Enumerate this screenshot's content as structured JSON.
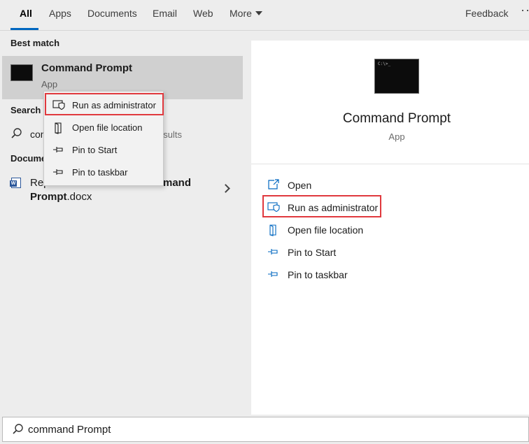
{
  "tabs": [
    {
      "label": "All",
      "active": true
    },
    {
      "label": "Apps"
    },
    {
      "label": "Documents"
    },
    {
      "label": "Email"
    },
    {
      "label": "Web"
    },
    {
      "label": "More"
    }
  ],
  "header": {
    "feedback_label": "Feedback",
    "more_options": "···"
  },
  "left": {
    "best_match_title": "Best match",
    "best_match": {
      "name": "Command Prompt",
      "type": "App",
      "icon": "command-prompt-icon"
    },
    "search_web_title": "Search t",
    "web_result": {
      "query_visible": "con",
      "suffix_visible": "esults",
      "icon": "search-icon"
    },
    "documents_title": "Docume",
    "document": {
      "line1_start": "Rep",
      "line1_end": "mand",
      "line2_bold": "Prompt",
      "line2_rest": ".docx",
      "icon": "word-doc-icon"
    }
  },
  "context_menu": {
    "items": [
      {
        "label": "Run as administrator",
        "icon": "shield-icon",
        "highlighted": true
      },
      {
        "label": "Open file location",
        "icon": "folder-location-icon"
      },
      {
        "label": "Pin to Start",
        "icon": "pin-icon"
      },
      {
        "label": "Pin to taskbar",
        "icon": "pin-icon"
      }
    ]
  },
  "right": {
    "app_name": "Command Prompt",
    "app_type": "App",
    "actions": [
      {
        "label": "Open",
        "icon": "open-icon"
      },
      {
        "label": "Run as administrator",
        "icon": "shield-icon",
        "highlighted": true
      },
      {
        "label": "Open file location",
        "icon": "folder-location-icon"
      },
      {
        "label": "Pin to Start",
        "icon": "pin-icon"
      },
      {
        "label": "Pin to taskbar",
        "icon": "pin-icon"
      }
    ]
  },
  "search": {
    "value": "command Prompt",
    "icon": "search-icon"
  },
  "colors": {
    "accent": "#0067c0",
    "highlight_box": "#e0393e",
    "icon_blue": "#0067c0"
  }
}
